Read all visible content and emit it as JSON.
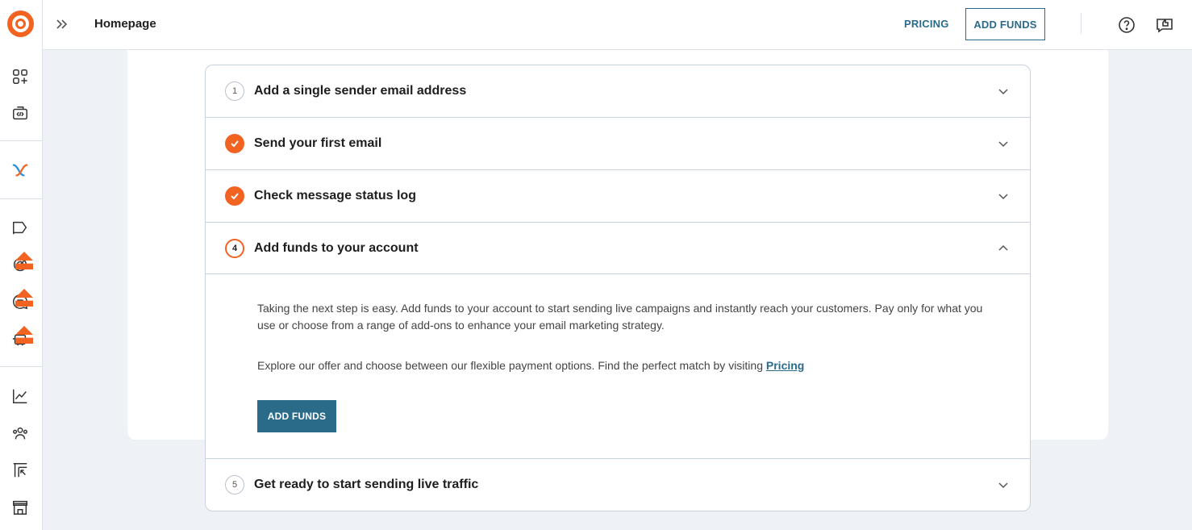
{
  "header": {
    "title": "Homepage",
    "pricing_label": "PRICING",
    "add_funds_label": "ADD FUNDS"
  },
  "sidebar": {
    "icons": [
      "logo-icon",
      "apps-add-icon",
      "api-code-icon",
      "connect-x-icon",
      "campaign-flag-icon",
      "target-icon",
      "chat-icon",
      "robot-icon",
      "analytics-chart-icon",
      "contacts-icon",
      "templates-icon",
      "store-icon"
    ]
  },
  "steps": [
    {
      "number": "1",
      "title": "Add a single sender email address",
      "status": "pending",
      "expanded": false
    },
    {
      "number": "2",
      "title": "Send your first email",
      "status": "done",
      "expanded": false
    },
    {
      "number": "3",
      "title": "Check message status log",
      "status": "done",
      "expanded": false
    },
    {
      "number": "4",
      "title": "Add funds to your account",
      "status": "active",
      "expanded": true
    },
    {
      "number": "5",
      "title": "Get ready to start sending live traffic",
      "status": "pending",
      "expanded": false
    }
  ],
  "step4_body": {
    "paragraph1": "Taking the next step is easy. Add funds to your account to start sending live campaigns and instantly reach your customers. Pay only for what you use or choose from a range of add-ons to enhance your email marketing strategy.",
    "paragraph2": "Explore our offer and choose between our flexible payment options. Find the perfect match by visiting",
    "pricing_link": "Pricing",
    "button_label": "ADD FUNDS"
  },
  "colors": {
    "accent_orange": "#f26322",
    "primary_teal": "#2b6b8a",
    "background": "#eef1f6"
  }
}
